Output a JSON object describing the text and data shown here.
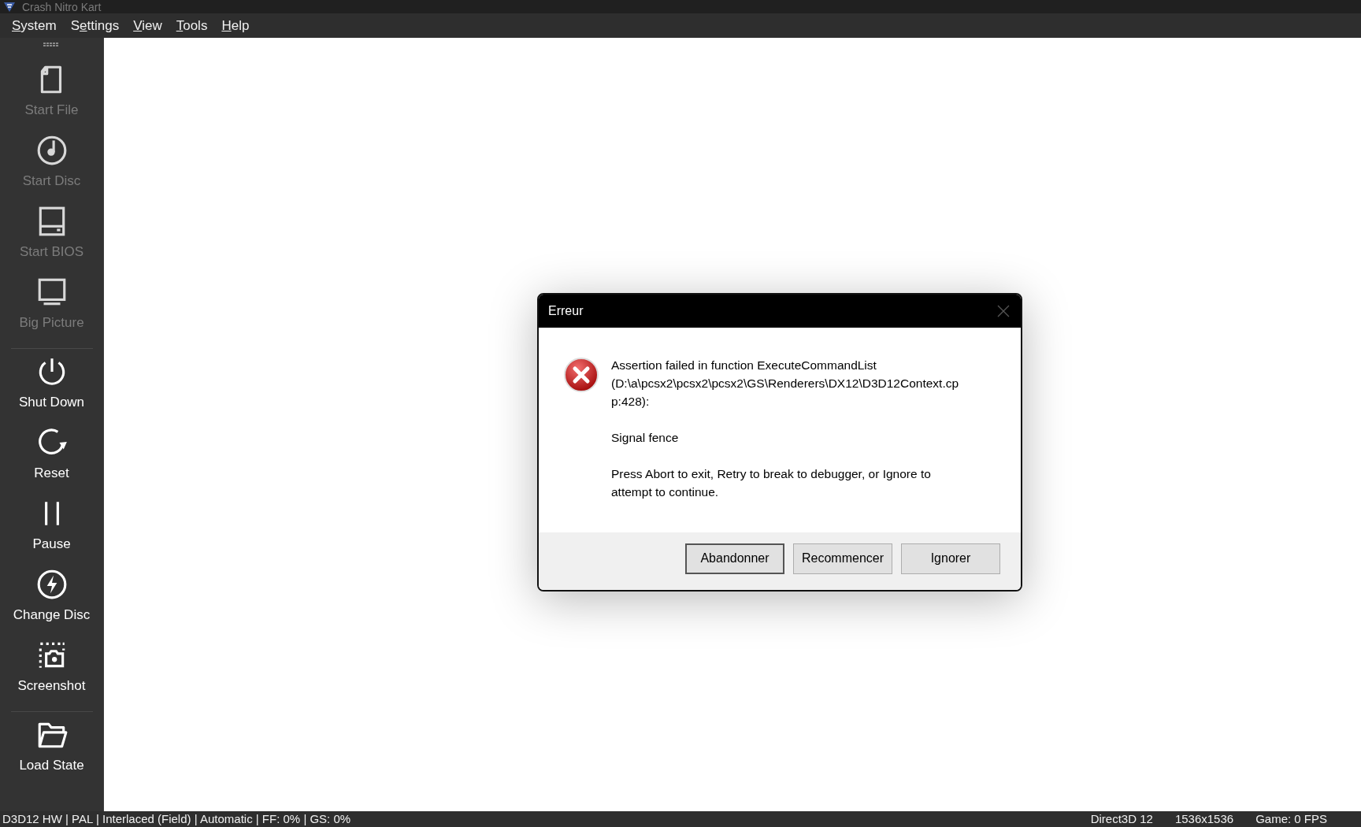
{
  "window": {
    "title": "Crash Nitro Kart"
  },
  "menu": [
    {
      "key": "S",
      "after": "ystem"
    },
    {
      "before": "S",
      "key": "e",
      "after": "ttings"
    },
    {
      "key": "V",
      "after": "iew"
    },
    {
      "key": "T",
      "after": "ools"
    },
    {
      "key": "H",
      "after": "elp"
    }
  ],
  "toolbar": [
    {
      "kind": "file",
      "label": "Start File",
      "disabled": true
    },
    {
      "kind": "disc",
      "label": "Start Disc",
      "disabled": true
    },
    {
      "kind": "bios",
      "label": "Start BIOS",
      "disabled": true
    },
    {
      "kind": "monitor",
      "label": "Big Picture",
      "disabled": true
    },
    {
      "kind": "separator"
    },
    {
      "kind": "power",
      "label": "Shut Down",
      "disabled": false
    },
    {
      "kind": "reset",
      "label": "Reset",
      "disabled": false
    },
    {
      "kind": "pause",
      "label": "Pause",
      "disabled": false
    },
    {
      "kind": "bolt",
      "label": "Change Disc",
      "disabled": false
    },
    {
      "kind": "screenshot",
      "label": "Screenshot",
      "disabled": false
    },
    {
      "kind": "separator"
    },
    {
      "kind": "folder",
      "label": "Load State",
      "disabled": false
    }
  ],
  "dialog": {
    "title": "Erreur",
    "paragraphs": [
      "Assertion failed in function ExecuteCommandList\n(D:\\a\\pcsx2\\pcsx2\\pcsx2\\GS\\Renderers\\DX12\\D3D12Context.cp\np:428):",
      "Signal fence",
      "Press Abort to exit, Retry to break to debugger, or Ignore to\nattempt to continue."
    ],
    "buttons": [
      {
        "label": "Abandonner",
        "default": true
      },
      {
        "label": "Recommencer",
        "default": false
      },
      {
        "label": "Ignorer",
        "default": false
      }
    ]
  },
  "status_bar": {
    "left": "D3D12 HW | PAL | Interlaced (Field) | Automatic | FF: 0% | GS: 0%",
    "right": [
      "Direct3D 12",
      "1536x1536",
      "Game: 0 FPS"
    ]
  }
}
